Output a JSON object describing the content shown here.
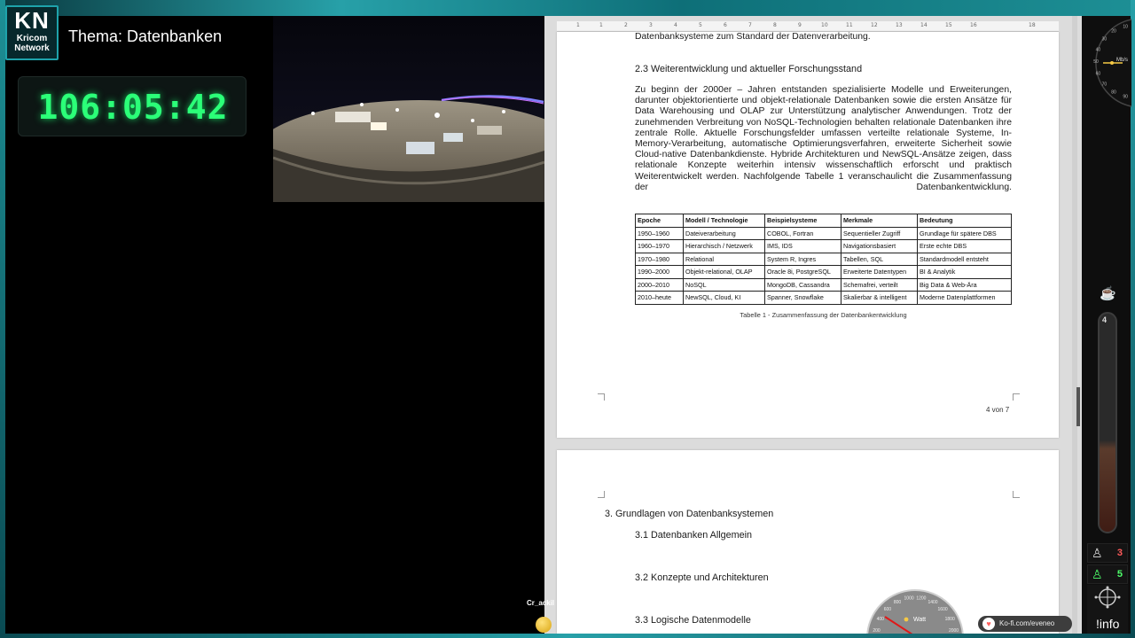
{
  "branding": {
    "logo_big": "KN",
    "logo_line1": "Kricom",
    "logo_line2": "Network",
    "topic": "Thema: Datenbanken"
  },
  "timer": "106:05:42",
  "document": {
    "ruler_marks": [
      "1",
      "1",
      "2",
      "3",
      "4",
      "5",
      "6",
      "7",
      "8",
      "9",
      "10",
      "11",
      "12",
      "13",
      "14",
      "15",
      "16",
      "18"
    ],
    "line_top": "Datenbanksysteme zum Standard der Datenverarbeitung.",
    "section_title": "2.3 Weiterentwicklung und aktueller Forschungsstand",
    "para_lines": [
      "Zu beginn der 2000er – Jahren entstanden spezialisierte Modelle und Erweiterungen,",
      "darunter objektorientierte und objekt-relationale Datenbanken sowie die ersten Ansätze für",
      "Data Warehousing und OLAP zur Unterstützung analytischer Anwendungen. Trotz der",
      "zunehmenden Verbreitung von NoSQL-Technologien behalten relationale Datenbanken ihre",
      "zentrale Rolle. Aktuelle Forschungsfelder umfassen verteilte relationale Systeme, In-",
      "Memory-Verarbeitung, automatische Optimierungsverfahren, erweiterte Sicherheit sowie",
      "Cloud-native Datenbankdienste. Hybride Architekturen und NewSQL-Ansätze zeigen, dass",
      "relationale Konzepte weiterhin intensiv wissenschaftlich erforscht und praktisch",
      "Weiterentwickelt werden. Nachfolgende Tabelle 1 veranschaulicht die Zusammenfassung"
    ],
    "para_last_left": "der",
    "para_last_right": "Datenbankentwicklung.",
    "table": {
      "headers": [
        "Epoche",
        "Modell / Technologie",
        "Beispielsysteme",
        "Merkmale",
        "Bedeutung"
      ],
      "rows": [
        [
          "1950–1960",
          "Dateiverarbeitung",
          "COBOL, Fortran",
          "Sequentieller Zugriff",
          "Grundlage für spätere DBS"
        ],
        [
          "1960–1970",
          "Hierarchisch / Netzwerk",
          "IMS, IDS",
          "Navigationsbasiert",
          "Erste echte DBS"
        ],
        [
          "1970–1980",
          "Relational",
          "System R, Ingres",
          "Tabellen, SQL",
          "Standardmodell entsteht"
        ],
        [
          "1990–2000",
          "Objekt-relational, OLAP",
          "Oracle 8i, PostgreSQL",
          "Erweiterte Datentypen",
          "BI & Analytik"
        ],
        [
          "2000–2010",
          "NoSQL",
          "MongoDB, Cassandra",
          "Schemafrei, verteilt",
          "Big Data & Web-Ära"
        ],
        [
          "2010–heute",
          "NewSQL, Cloud, KI",
          "Spanner, Snowflake",
          "Skalierbar & intelligent",
          "Moderne Datenplattformen"
        ]
      ]
    },
    "caption": "Tabelle 1 - Zusammenfassung der Datenbankentwicklung",
    "page_number": "4 von 7",
    "page2": {
      "chapter": "3. Grundlagen von Datenbanksystemen",
      "s1": "3.1 Datenbanken Allgemein",
      "s2": "3.2 Konzepte und Architekturen",
      "s3": "3.3 Logische Datenmodelle"
    }
  },
  "side_panel": {
    "speed_label": "Mb/s",
    "speed_ticks": [
      "10",
      "20",
      "30",
      "40",
      "50",
      "60",
      "70",
      "80",
      "90"
    ],
    "tube_count": "4",
    "users_a": "3",
    "users_b": "5",
    "info_label": "!info",
    "colors": {
      "accent_teal": "#1ea3ab",
      "timer_green": "#2bff78",
      "users_a": "#ff5a5a",
      "users_b": "#4dff6a"
    }
  },
  "overlay": {
    "viewer_name": "Cr_ackil",
    "kofi_text": "Ko-fi.com/eveneo",
    "watt_label": "Watt",
    "watt_ticks": [
      "200",
      "400",
      "600",
      "800",
      "1000",
      "1200",
      "1400",
      "1600",
      "1800",
      "2000"
    ]
  }
}
